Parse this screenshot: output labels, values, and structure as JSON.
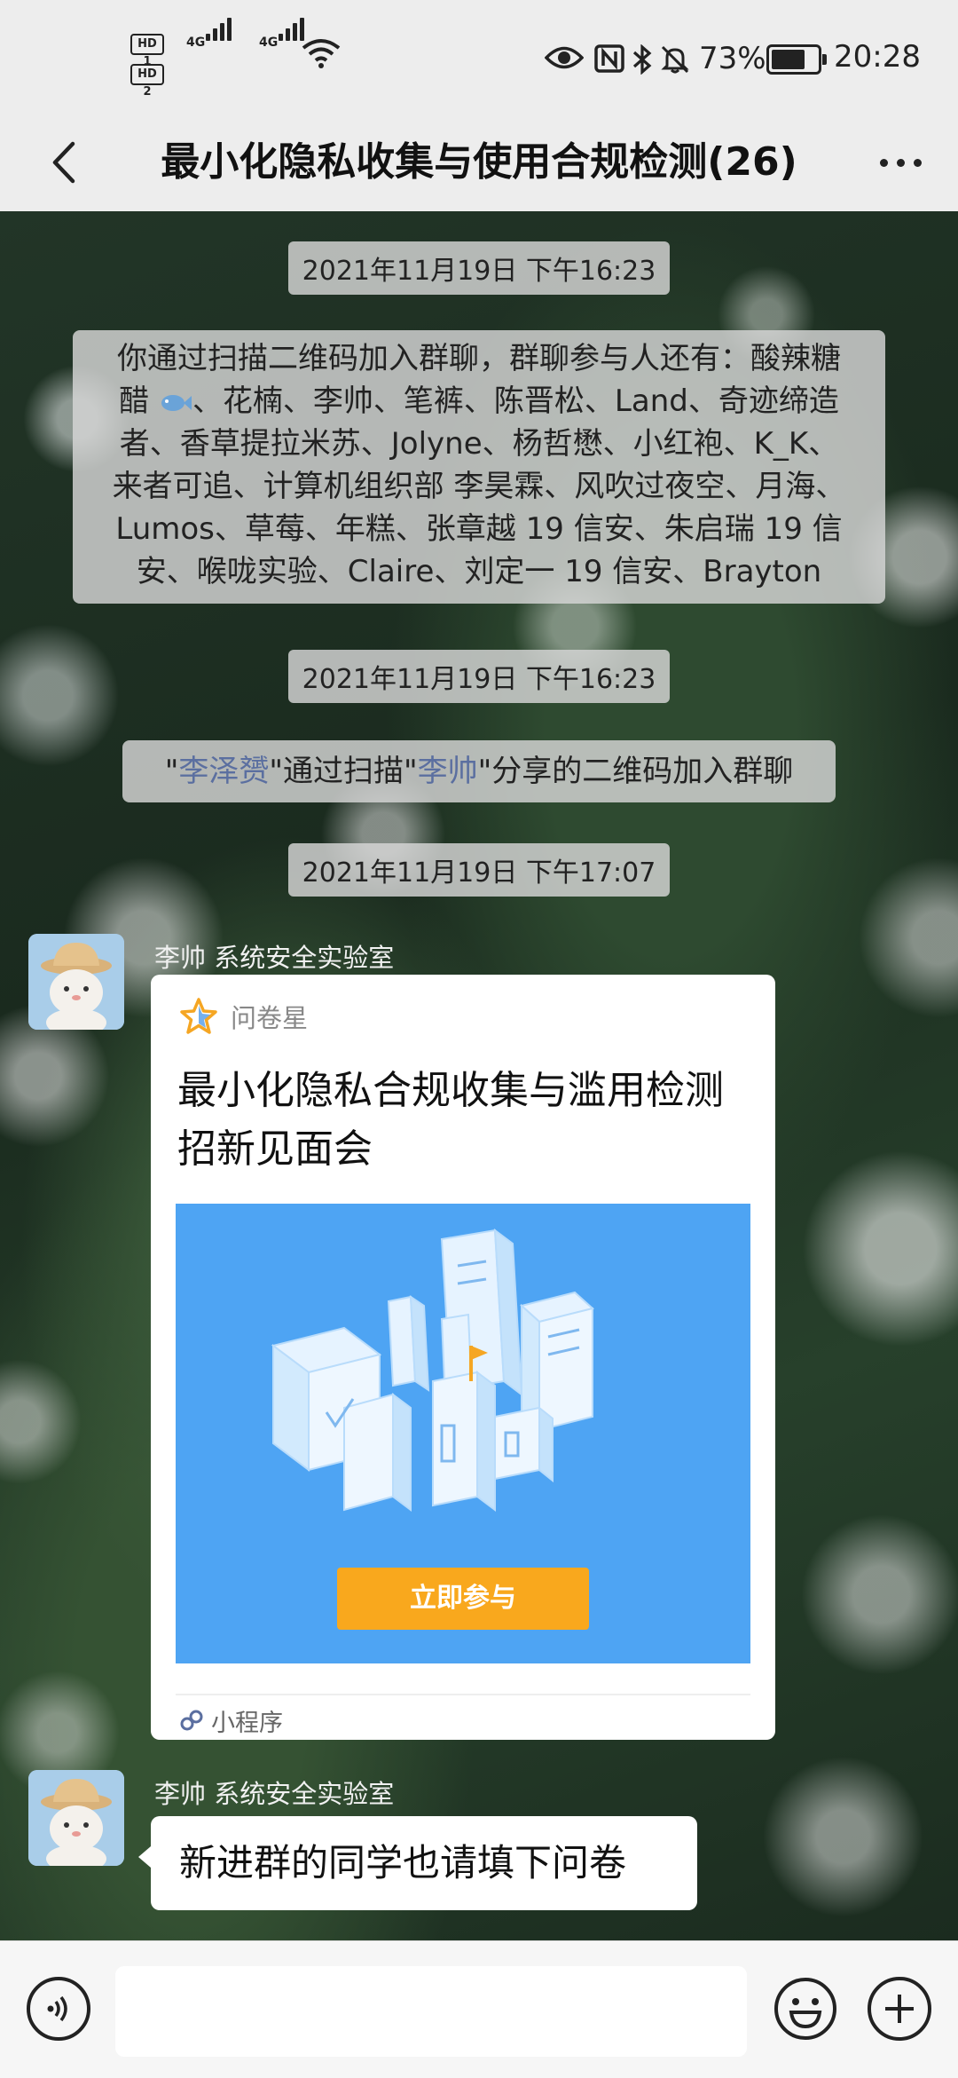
{
  "status_bar": {
    "hd1": "HD 1",
    "hd2": "HD 2",
    "network1": "4G",
    "network2": "4G",
    "battery": "73%",
    "time": "20:28",
    "icons": [
      "eye-icon",
      "nfc-icon",
      "bluetooth-icon",
      "mute-icon",
      "battery-icon",
      "wifi-icon",
      "signal-icon"
    ]
  },
  "header": {
    "title": "最小化隐私收集与使用合规检测(26)",
    "back_icon": "chevron-left-icon",
    "more_icon": "more-dots-icon"
  },
  "messages": {
    "time1": "2021年11月19日 下午16:23",
    "join_notice": {
      "line1": "你通过扫描二维码加入群聊，群聊参与人还有：酸辣糖",
      "line2": "醋",
      "line2b": "、花楠、李帅、笔裤、陈晋松、Land、奇迹缔造",
      "line3": "者、香草提拉米苏、Jolyne、杨哲懋、小红袍、K_K、",
      "line4": "来者可追、计算机组织部 李昊霖、风吹过夜空、月海、",
      "line5": "Lumos、草莓、年糕、张章越 19 信安、朱启瑞 19 信",
      "line6": "安、喉咙实验、Claire、刘定一 19 信安、Brayton"
    },
    "time2": "2021年11月19日 下午16:23",
    "scan_notice": {
      "prefix": "\"",
      "name1": "李泽赟",
      "middle": "\"通过扫描\"",
      "name2": "李帅",
      "suffix": "\"分享的二维码加入群聊"
    },
    "time3": "2021年11月19日 下午17:07",
    "sender1": "李帅 系统安全实验室",
    "card": {
      "source": "问卷星",
      "title_line1": "最小化隐私合规收集与滥用检测",
      "title_line2": "招新见面会",
      "button": "立即参与",
      "footer": "小程序"
    },
    "sender2": "李帅 系统安全实验室",
    "text_message": "新进群的同学也请填下问卷"
  },
  "input_bar": {
    "voice_icon": "voice-icon",
    "emoji_icon": "emoji-icon",
    "plus_icon": "plus-icon"
  },
  "colors": {
    "link": "#5b6fa0",
    "card_image_bg": "#4ea4f3",
    "join_button": "#f9a81d"
  }
}
